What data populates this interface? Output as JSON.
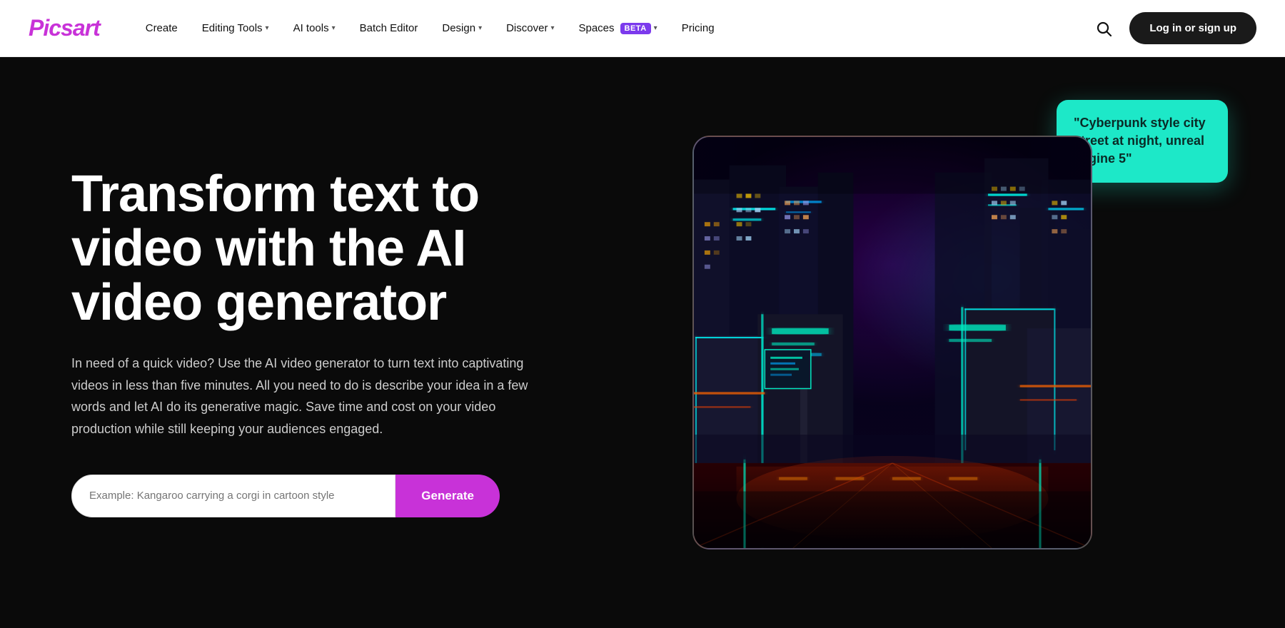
{
  "navbar": {
    "logo": "Picsart",
    "links": [
      {
        "id": "create",
        "label": "Create",
        "hasDropdown": false
      },
      {
        "id": "editing-tools",
        "label": "Editing Tools",
        "hasDropdown": true
      },
      {
        "id": "ai-tools",
        "label": "AI tools",
        "hasDropdown": true
      },
      {
        "id": "batch-editor",
        "label": "Batch Editor",
        "hasDropdown": false
      },
      {
        "id": "design",
        "label": "Design",
        "hasDropdown": true
      },
      {
        "id": "discover",
        "label": "Discover",
        "hasDropdown": true
      },
      {
        "id": "spaces",
        "label": "Spaces",
        "hasDropdown": true,
        "badge": "BETA"
      },
      {
        "id": "pricing",
        "label": "Pricing",
        "hasDropdown": false
      }
    ],
    "login_label": "Log in or sign up"
  },
  "hero": {
    "title": "Transform text to video with the AI video generator",
    "description": "In need of a quick video? Use the AI video generator to turn text into captivating videos in less than five minutes. All you need to do is describe your idea in a few words and let AI do its generative magic. Save time and cost on your video production while still keeping your audiences engaged.",
    "input_placeholder": "Example: Kangaroo carrying a corgi in cartoon style",
    "generate_label": "Generate",
    "speech_bubble_text": "\"Cyberpunk style city street at night, unreal engine 5\""
  },
  "colors": {
    "logo": "#c832d8",
    "generate_btn": "#c832d8",
    "beta_badge": "#7c3aed",
    "speech_bubble": "#1de8c8",
    "login_btn_bg": "#1a1a1a"
  }
}
